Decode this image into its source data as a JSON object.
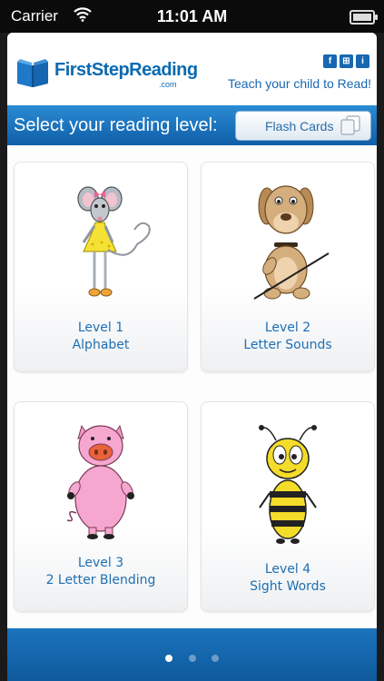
{
  "status": {
    "carrier": "Carrier",
    "time": "11:01 AM"
  },
  "header": {
    "brand": "FirstStepReading",
    "brand_suffix": ".com",
    "tagline": "Teach your child to Read!",
    "icons": [
      "facebook-icon",
      "windows-icon",
      "info-icon"
    ]
  },
  "levelbar": {
    "title": "Select your reading level:",
    "flash_cards_label": "Flash Cards"
  },
  "levels": [
    {
      "line1": "Level 1",
      "line2": "Alphabet",
      "character": "mouse"
    },
    {
      "line1": "Level 2",
      "line2": "Letter Sounds",
      "character": "dog"
    },
    {
      "line1": "Level 3",
      "line2": "2 Letter Blending",
      "character": "pig"
    },
    {
      "line1": "Level 4",
      "line2": "Sight Words",
      "character": "bee"
    }
  ],
  "pager": {
    "pages": 3,
    "active": 1
  }
}
